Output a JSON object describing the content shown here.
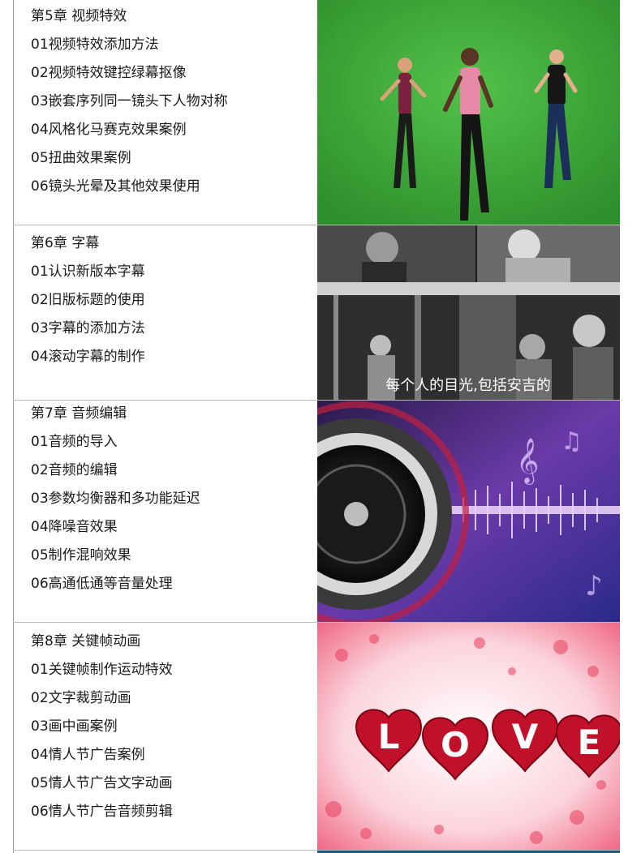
{
  "chapters": [
    {
      "title": "第5章 视频特效",
      "lessons": [
        "01视频特效添加方法",
        "02视频特效键控绿幕抠像",
        "03嵌套序列同一镜头下人物对称",
        "04风格化马赛克效果案例",
        "05扭曲效果案例",
        "06镜头光晕及其他效果使用"
      ]
    },
    {
      "title": "第6章  字幕",
      "lessons": [
        "01认识新版本字幕",
        "02旧版标题的使用",
        "03字幕的添加方法",
        "04滚动字幕的制作"
      ],
      "image_caption": "每个人的目光,包括安吉的"
    },
    {
      "title": "第7章 音频编辑",
      "lessons": [
        "01音频的导入",
        "02音频的编辑",
        "03参数均衡器和多功能延迟",
        "04降噪音效果",
        "05制作混响效果",
        "06高通低通等音量处理"
      ]
    },
    {
      "title": "第8章  关键帧动画",
      "lessons": [
        "01关键帧制作运动特效",
        "02文字裁剪动画",
        "03画中画案例",
        "04情人节广告案例",
        "05情人节广告文字动画",
        "06情人节广告音频剪辑"
      ],
      "image_letters": [
        "L",
        "O",
        "V",
        "E"
      ]
    }
  ],
  "colors": {
    "greenscreen": "#3fa83a",
    "speaker_purple": "#5a2a8a",
    "love_pink": "#f7c0cc",
    "heart_red": "#c0102a"
  }
}
